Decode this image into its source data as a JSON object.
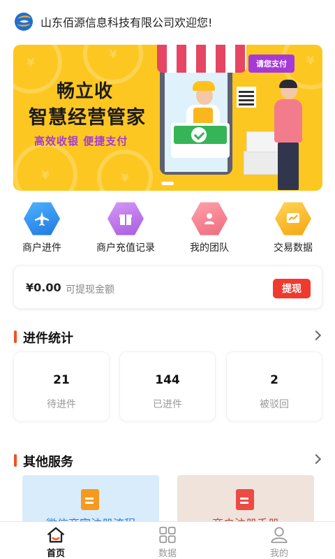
{
  "header": {
    "welcome": "山东佰源信息科技有限公司欢迎您!"
  },
  "banner": {
    "title_line1": "畅立收",
    "title_line2": "智慧经营管家",
    "subtitle": "高效收银  便捷支付",
    "pay_tag": "请您支付"
  },
  "quick_actions": [
    {
      "label": "商户进件",
      "icon": "airplane-icon",
      "color": "#2f8fe8"
    },
    {
      "label": "商户充值记录",
      "icon": "gift-icon",
      "color": "#b86ee6"
    },
    {
      "label": "我的团队",
      "icon": "team-icon",
      "color": "#f27a8a"
    },
    {
      "label": "交易数据",
      "icon": "chart-icon",
      "color": "#fcb714"
    }
  ],
  "balance": {
    "amount": "¥0.00",
    "label": "可提现金额",
    "withdraw_label": "提现"
  },
  "stats_section": {
    "title": "进件统计",
    "items": [
      {
        "value": "21",
        "label": "待进件"
      },
      {
        "value": "144",
        "label": "已进件"
      },
      {
        "value": "2",
        "label": "被驳回"
      }
    ]
  },
  "services_section": {
    "title": "其他服务",
    "items": [
      {
        "label": "微信商家注册流程",
        "icon": "document-icon",
        "bg": "#d9ecfb",
        "icon_color": "#f59a1f",
        "text_color": "#2b7bd6"
      },
      {
        "label": "商户注册手册",
        "icon": "document-icon",
        "bg": "#efe3dc",
        "icon_color": "#ee4a44",
        "text_color": "#b4493a"
      }
    ]
  },
  "tabbar": {
    "items": [
      {
        "label": "首页",
        "icon": "home-icon",
        "active": true
      },
      {
        "label": "数据",
        "icon": "grid-icon",
        "active": false
      },
      {
        "label": "我的",
        "icon": "profile-icon",
        "active": false
      }
    ]
  },
  "colors": {
    "accent_red": "#f03a2f",
    "section_mark": "#f05124",
    "banner_yellow": "#fdc722"
  }
}
